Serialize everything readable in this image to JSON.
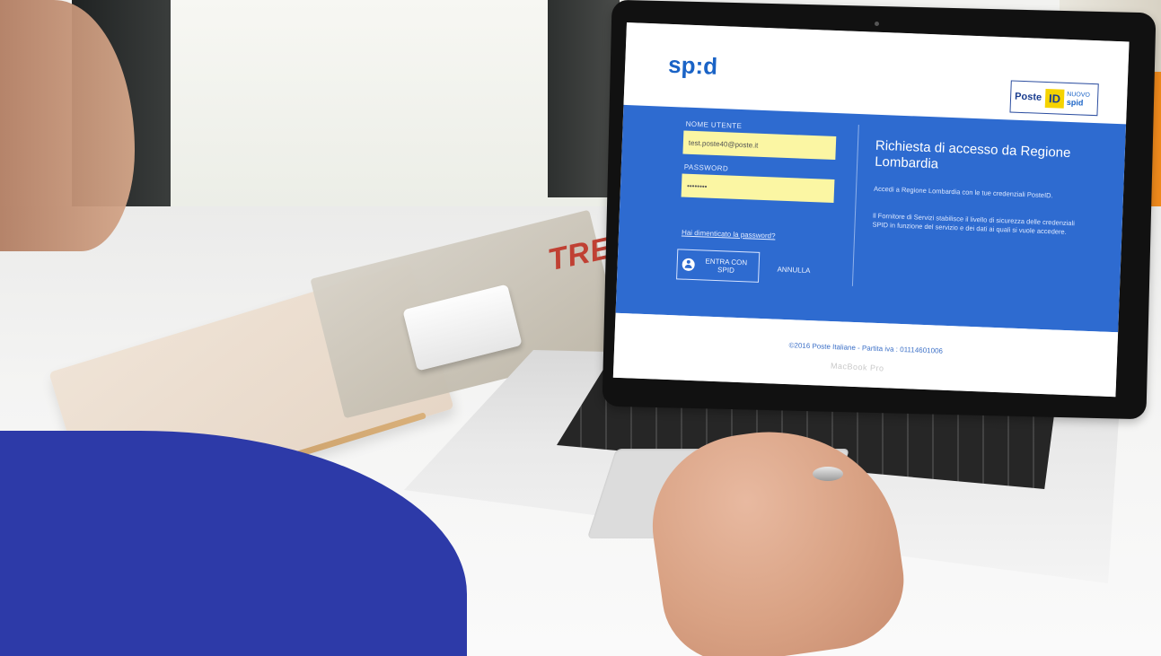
{
  "screen": {
    "logo": "sp:d",
    "poste_badge": {
      "label": "Poste",
      "id": "ID",
      "nuovo": "NUOVO",
      "spid": "spid"
    },
    "form": {
      "username_label": "NOME UTENTE",
      "username_value": "test.poste40@poste.it",
      "password_label": "PASSWORD",
      "password_value": "••••••••",
      "forgot_link": "Hai dimenticato la password?",
      "submit_label": "ENTRA CON SPID",
      "cancel_label": "ANNULLA"
    },
    "info": {
      "title": "Richiesta di accesso da Regione Lombardia",
      "paragraph1": "Accedi a Regione Lombardia con le tue credenziali PosteID.",
      "paragraph2": "Il Fornitore di Servizi stabilisce il livello di sicurezza delle credenziali SPID in funzione del servizio e dei dati ai quali si vuole accedere."
    },
    "footer": "©2016 Poste Italiane - Partita iva : 01114601006"
  },
  "device": {
    "label": "MacBook Pro"
  },
  "background": {
    "magazine_text": "TREL"
  },
  "colors": {
    "spid_blue": "#2e6bd0",
    "input_yellow": "#fbf6a3",
    "poste_yellow": "#f5d300"
  }
}
